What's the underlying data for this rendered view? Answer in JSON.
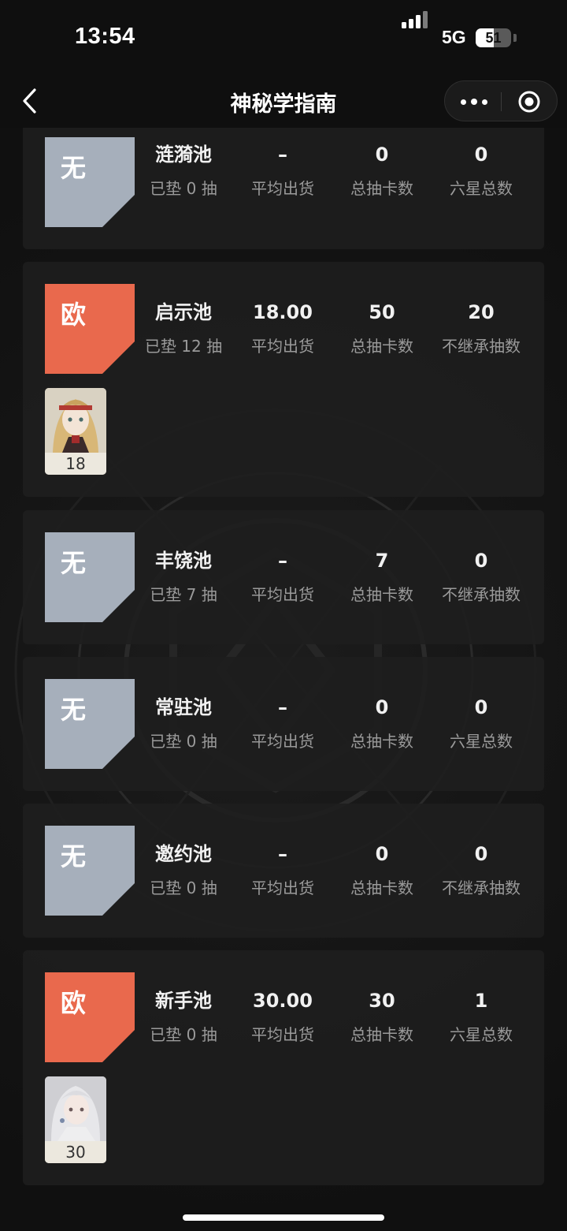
{
  "status_bar": {
    "time": "13:54",
    "network": "5G",
    "battery": "51",
    "battery_level": 0.51
  },
  "nav": {
    "title": "神秘学指南",
    "back_icon": "chevron-left-icon",
    "more_icon": "more-dots-icon",
    "close_icon": "target-circle-icon"
  },
  "colors": {
    "rank_none": "#a6afbb",
    "rank_lucky": "#e9694d",
    "card_bg": "#1e1e1e",
    "label_gray": "#9a9a9a"
  },
  "pools": [
    {
      "rank": "无",
      "name": "涟漪池",
      "pity": "已垫 0 抽",
      "avg_value": "–",
      "avg_label": "平均出货",
      "total_value": "0",
      "total_label": "总抽卡数",
      "extra_value": "0",
      "extra_label": "六星总数"
    },
    {
      "rank": "欧",
      "name": "启示池",
      "pity": "已垫 12 抽",
      "avg_value": "18.00",
      "avg_label": "平均出货",
      "total_value": "50",
      "total_label": "总抽卡数",
      "extra_value": "20",
      "extra_label": "不继承抽数",
      "pulls": [
        "18"
      ]
    },
    {
      "rank": "无",
      "name": "丰饶池",
      "pity": "已垫 7 抽",
      "avg_value": "–",
      "avg_label": "平均出货",
      "total_value": "7",
      "total_label": "总抽卡数",
      "extra_value": "0",
      "extra_label": "不继承抽数"
    },
    {
      "rank": "无",
      "name": "常驻池",
      "pity": "已垫 0 抽",
      "avg_value": "–",
      "avg_label": "平均出货",
      "total_value": "0",
      "total_label": "总抽卡数",
      "extra_value": "0",
      "extra_label": "六星总数"
    },
    {
      "rank": "无",
      "name": "邀约池",
      "pity": "已垫 0 抽",
      "avg_value": "–",
      "avg_label": "平均出货",
      "total_value": "0",
      "total_label": "总抽卡数",
      "extra_value": "0",
      "extra_label": "不继承抽数"
    },
    {
      "rank": "欧",
      "name": "新手池",
      "pity": "已垫 0 抽",
      "avg_value": "30.00",
      "avg_label": "平均出货",
      "total_value": "30",
      "total_label": "总抽卡数",
      "extra_value": "1",
      "extra_label": "六星总数",
      "pulls": [
        "30"
      ]
    }
  ]
}
